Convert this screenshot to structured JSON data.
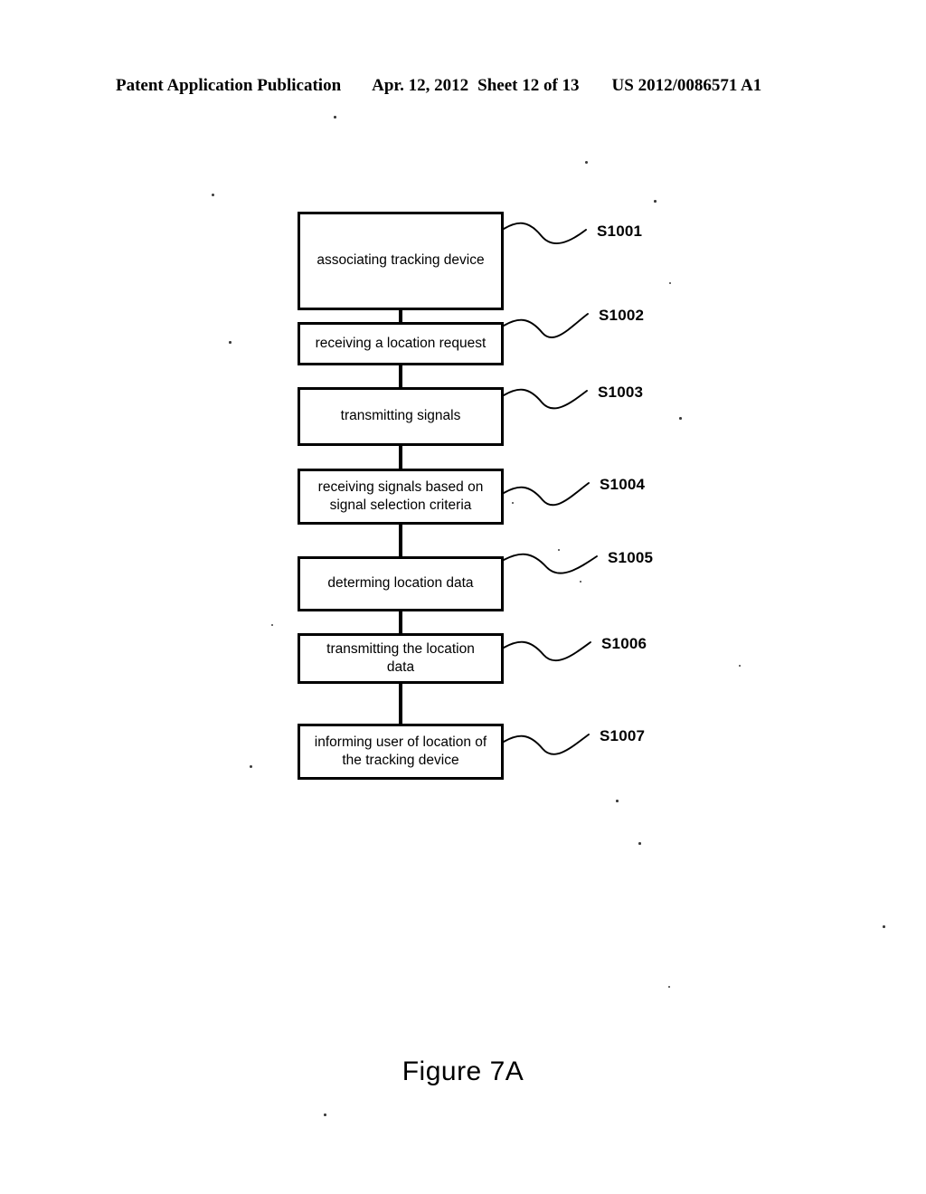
{
  "header": {
    "publication": "Patent Application Publication",
    "date": "Apr. 12, 2012",
    "sheet": "Sheet 12 of 13",
    "patent_number": "US 2012/0086571 A1"
  },
  "figure": {
    "caption": "Figure 7A",
    "type": "flowchart",
    "orientation": "vertical",
    "steps": [
      {
        "ref": "S1001",
        "text": "associating tracking device"
      },
      {
        "ref": "S1002",
        "text": "receiving a location request"
      },
      {
        "ref": "S1003",
        "text": "transmitting signals"
      },
      {
        "ref": "S1004",
        "text": "receiving signals based on\nsignal selection criteria"
      },
      {
        "ref": "S1005",
        "text": "determing location data"
      },
      {
        "ref": "S1006",
        "text": "transmitting the location\ndata"
      },
      {
        "ref": "S1007",
        "text": "informing user of location of\nthe tracking device"
      }
    ]
  },
  "colors": {
    "ink": "#000000",
    "paper": "#ffffff"
  }
}
